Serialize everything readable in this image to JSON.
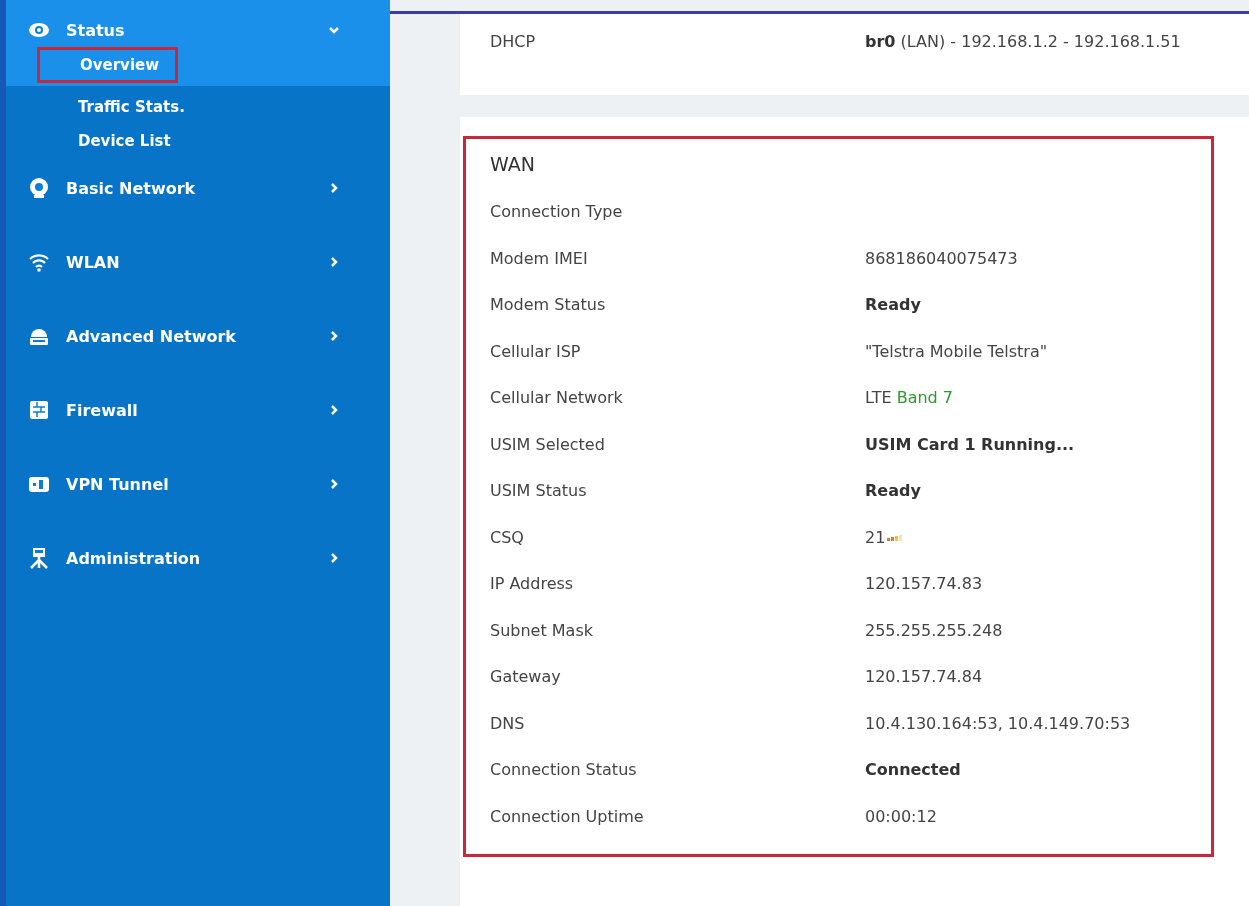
{
  "sidebar": {
    "items": [
      {
        "label": "Status",
        "expanded": true,
        "children": [
          {
            "label": "Overview",
            "selected": true,
            "annotated": true
          },
          {
            "label": "Traffic Stats.",
            "selected": false,
            "annotated": false
          },
          {
            "label": "Device List",
            "selected": false,
            "annotated": false
          }
        ]
      },
      {
        "label": "Basic Network",
        "expanded": false
      },
      {
        "label": "WLAN",
        "expanded": false
      },
      {
        "label": "Advanced Network",
        "expanded": false
      },
      {
        "label": "Firewall",
        "expanded": false
      },
      {
        "label": "VPN Tunnel",
        "expanded": false
      },
      {
        "label": "Administration",
        "expanded": false
      }
    ]
  },
  "lan_card": {
    "rows": [
      {
        "label": "DHCP",
        "value_bold": "br0",
        "value": " (LAN) - 192.168.1.2 - 192.168.1.51"
      }
    ]
  },
  "wan_card": {
    "title": "WAN",
    "annotated": true,
    "rows": [
      {
        "label": "Connection Type",
        "value": ""
      },
      {
        "label": "Modem IMEI",
        "value": "868186040075473"
      },
      {
        "label": "Modem Status",
        "value": "Ready",
        "strong": true
      },
      {
        "label": "Cellular ISP",
        "value": "\"Telstra Mobile Telstra\""
      },
      {
        "label": "Cellular Network",
        "value": "LTE ",
        "highlight": "Band 7"
      },
      {
        "label": "USIM Selected",
        "value": "USIM Card 1 Running...",
        "strong": true
      },
      {
        "label": "USIM Status",
        "value": "Ready",
        "strong": true
      },
      {
        "label": "CSQ",
        "value": "21 ",
        "signal": true
      },
      {
        "label": "IP Address",
        "value": "120.157.74.83"
      },
      {
        "label": "Subnet Mask",
        "value": "255.255.255.248"
      },
      {
        "label": "Gateway",
        "value": "120.157.74.84"
      },
      {
        "label": "DNS",
        "value": "10.4.130.164:53, 10.4.149.70:53"
      },
      {
        "label": "Connection Status",
        "value": "Connected",
        "strong": true
      },
      {
        "label": "Connection Uptime",
        "value": "00:00:12"
      }
    ]
  }
}
